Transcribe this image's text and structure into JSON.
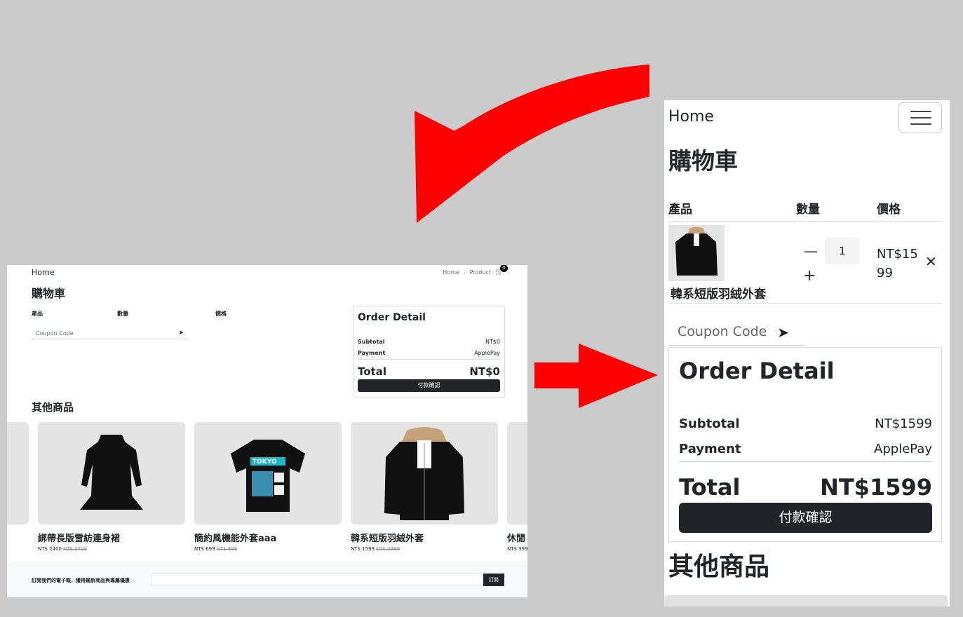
{
  "desktop": {
    "brand": "Home",
    "nav": {
      "home": "Home",
      "product": "Product",
      "cart_count": "0"
    },
    "cart_title": "購物車",
    "table_headers": {
      "product": "產品",
      "quantity": "數量",
      "price": "價格"
    },
    "coupon_placeholder": "Coupon Code",
    "order": {
      "title": "Order Detail",
      "subtotal_label": "Subtotal",
      "subtotal_value": "NT$0",
      "payment_label": "Payment",
      "payment_value": "ApplePay",
      "total_label": "Total",
      "total_value": "NT$0",
      "checkout_label": "付款確認"
    },
    "other_title": "其他商品",
    "products": [
      {
        "name": "綁帶長版雪紡連身裙",
        "price": "NT$ 2400",
        "old_price": "NT$ 2700"
      },
      {
        "name": "簡約風機能外套aaa",
        "price": "NT$ 699",
        "old_price": "NT$ 899"
      },
      {
        "name": "韓系短版羽絨外套",
        "price": "NT$ 1599",
        "old_price": "NT$ 2999"
      },
      {
        "name": "休閒",
        "price": "NT$ 399",
        "old_price": ""
      }
    ],
    "newsletter": {
      "text": "訂閱我們的電子報，獲得最新商品與專屬優惠",
      "button": "訂閱"
    }
  },
  "mobile": {
    "brand": "Home",
    "cart_title": "購物車",
    "table_headers": {
      "product": "產品",
      "quantity": "數量",
      "price": "價格"
    },
    "item": {
      "name": "韓系短版羽絨外套",
      "quantity": "1",
      "price": "NT$1599"
    },
    "coupon_placeholder": "Coupon Code",
    "order": {
      "title": "Order Detail",
      "subtotal_label": "Subtotal",
      "subtotal_value": "NT$1599",
      "payment_label": "Payment",
      "payment_value": "ApplePay",
      "total_label": "Total",
      "total_value": "NT$1599",
      "checkout_label": "付款確認"
    },
    "other_title": "其他商品"
  },
  "colors": {
    "arrow": "#ff0000",
    "button": "#212529",
    "background": "#cbcbcb"
  }
}
